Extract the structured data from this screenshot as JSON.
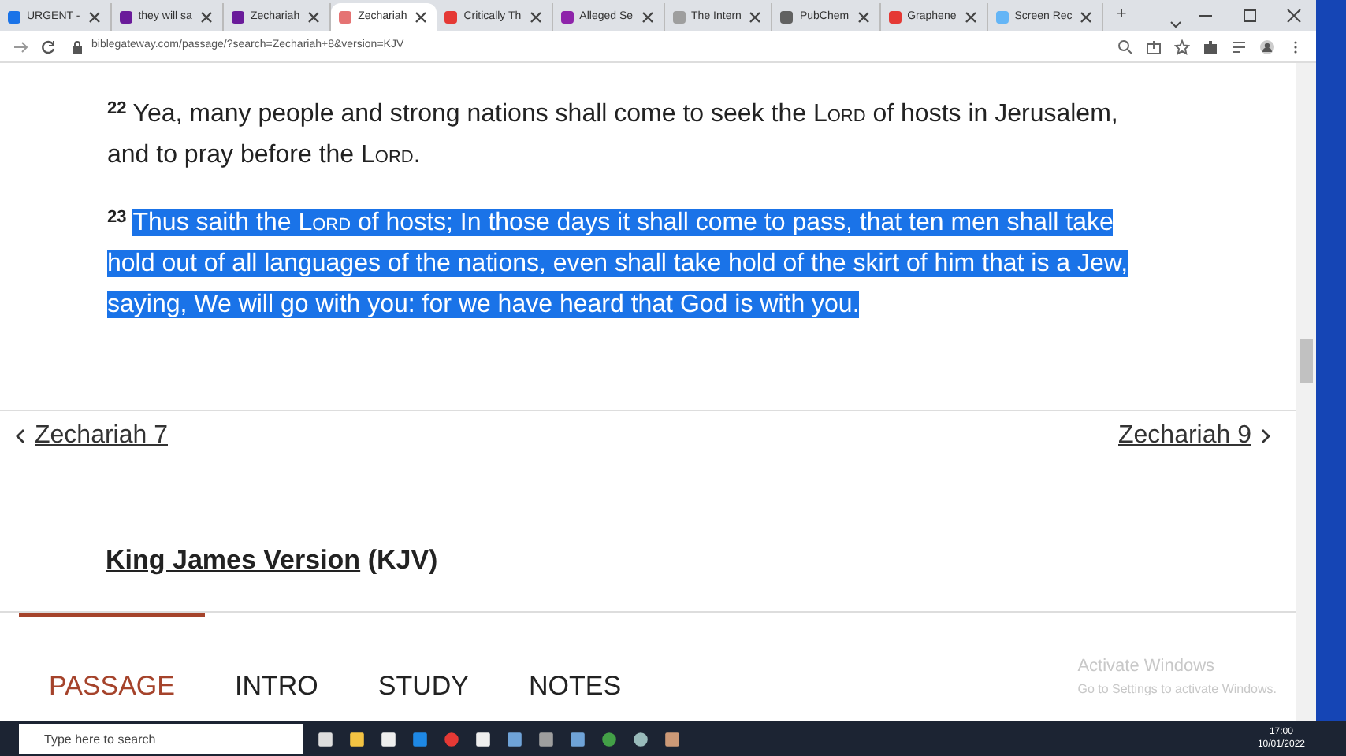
{
  "browser": {
    "tabs": [
      {
        "title": "URGENT -",
        "selected": false,
        "color": "#1a73e8"
      },
      {
        "title": "they will sa",
        "selected": false,
        "color": "#6a1b9a"
      },
      {
        "title": "Zechariah",
        "selected": false,
        "color": "#6a1b9a"
      },
      {
        "title": "Zechariah",
        "selected": true,
        "color": "#e57373"
      },
      {
        "title": "Critically Th",
        "selected": false,
        "color": "#e53935"
      },
      {
        "title": "Alleged Se",
        "selected": false,
        "color": "#8e24aa"
      },
      {
        "title": "The Intern",
        "selected": false,
        "color": "#9e9e9e"
      },
      {
        "title": "PubChem",
        "selected": false,
        "color": "#616161"
      },
      {
        "title": "Graphene",
        "selected": false,
        "color": "#e53935"
      },
      {
        "title": "Screen Rec",
        "selected": false,
        "color": "#64b5f6"
      }
    ],
    "new_tab": "+",
    "url": "biblegateway.com/passage/?search=Zechariah+8&version=KJV"
  },
  "verses": [
    {
      "number": "22",
      "selected": false,
      "parts": [
        {
          "text": "Yea, many people and strong nations shall come to seek the "
        },
        {
          "text": "Lord",
          "kind": "smallcaps"
        },
        {
          "text": " of hosts in Jerusalem, and to pray before the "
        },
        {
          "text": "Lord",
          "kind": "smallcaps"
        },
        {
          "text": "."
        }
      ]
    },
    {
      "number": "23",
      "selected": true,
      "parts": [
        {
          "text": "Thus saith the "
        },
        {
          "text": "Lord",
          "kind": "smallcaps"
        },
        {
          "text": " of hosts; In those days it shall come to pass, that ten men shall take hold out of all languages of the nations, even shall take hold of the skirt of him that is a Jew, saying, We will go with you: for we have heard that God is with you."
        }
      ]
    }
  ],
  "chapter_nav": {
    "previous": "Zechariah 7",
    "next": "Zechariah 9"
  },
  "version": {
    "name": "King James Version",
    "abbr": "(KJV)"
  },
  "bottom_tabs": [
    {
      "label": "PASSAGE",
      "selected": true
    },
    {
      "label": "INTRO",
      "selected": false
    },
    {
      "label": "STUDY",
      "selected": false
    },
    {
      "label": "NOTES",
      "selected": false
    }
  ],
  "activation": {
    "title": "Activate Windows",
    "hint": "Go to Settings to activate Windows."
  },
  "taskbar": {
    "search_placeholder": "Type here to search",
    "time": "17:00",
    "date": "10/01/2022"
  }
}
